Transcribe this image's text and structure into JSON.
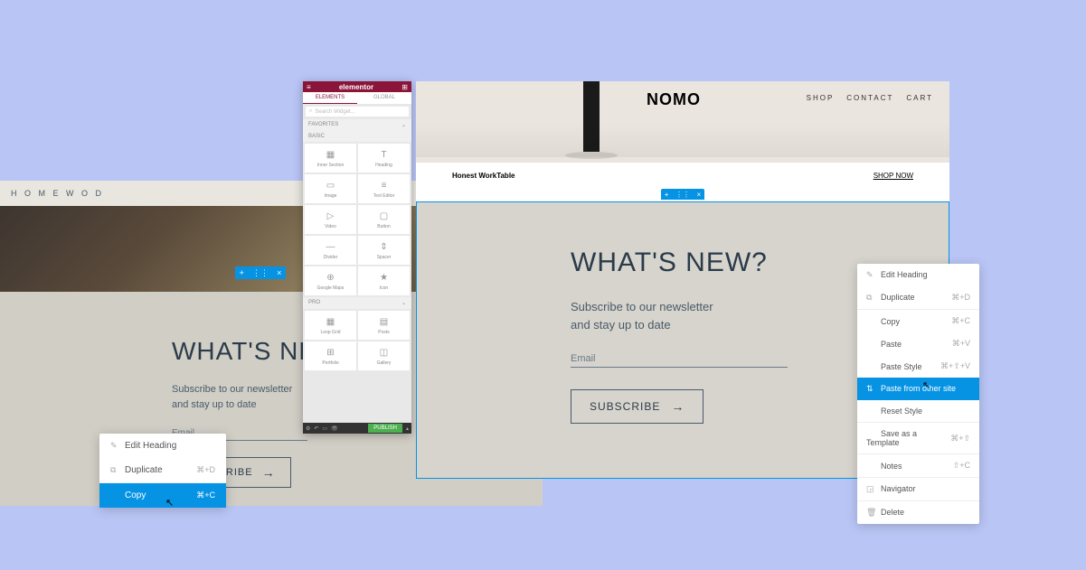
{
  "left_preview": {
    "logo": "H O M E W O D",
    "heading": "WHAT'S NEW?",
    "subscribe_text": "Subscribe to our newsletter\nand stay up to date",
    "email_placeholder": "Email",
    "subscribe_button": "SUBSCRIBE"
  },
  "left_context_menu": {
    "edit_heading": "Edit Heading",
    "duplicate": "Duplicate",
    "duplicate_shortcut": "⌘+D",
    "copy": "Copy",
    "copy_shortcut": "⌘+C"
  },
  "elementor": {
    "title": "elementor",
    "tabs": {
      "elements": "ELEMENTS",
      "global": "GLOBAL"
    },
    "search_placeholder": "Search Widget...",
    "sections": {
      "favorites": "FAVORITES",
      "basic": "BASIC",
      "pro": "PRO"
    },
    "widgets_basic": [
      {
        "label": "Inner Section",
        "icon": "▦"
      },
      {
        "label": "Heading",
        "icon": "T"
      },
      {
        "label": "Image",
        "icon": "▭"
      },
      {
        "label": "Text Editor",
        "icon": "≡"
      },
      {
        "label": "Video",
        "icon": "▷"
      },
      {
        "label": "Button",
        "icon": "▢"
      },
      {
        "label": "Divider",
        "icon": "—"
      },
      {
        "label": "Spacer",
        "icon": "⇕"
      },
      {
        "label": "Google Maps",
        "icon": "⊕"
      },
      {
        "label": "Icon",
        "icon": "★"
      }
    ],
    "widgets_pro": [
      {
        "label": "Loop Grid",
        "icon": "▦"
      },
      {
        "label": "Posts",
        "icon": "▤"
      },
      {
        "label": "Portfolio",
        "icon": "⊞"
      },
      {
        "label": "Gallery",
        "icon": "◫"
      }
    ],
    "publish": "PUBLISH"
  },
  "right_preview": {
    "logo": "NOMO",
    "nav": {
      "shop": "SHOP",
      "contact": "CONTACT",
      "cart": "CART"
    },
    "product_name": "Honest WorkTable",
    "shop_now": "SHOP NOW",
    "heading": "WHAT'S NEW?",
    "subscribe_text": "Subscribe to our newsletter\nand stay up to date",
    "email_placeholder": "Email",
    "subscribe_button": "SUBSCRIBE"
  },
  "right_context_menu": {
    "edit_heading": "Edit Heading",
    "duplicate": "Duplicate",
    "duplicate_shortcut": "⌘+D",
    "copy": "Copy",
    "copy_shortcut": "⌘+C",
    "paste": "Paste",
    "paste_shortcut": "⌘+V",
    "paste_style": "Paste Style",
    "paste_style_shortcut": "⌘+⇧+V",
    "paste_from_other": "Paste from other site",
    "reset_style": "Reset Style",
    "save_template": "Save as a Template",
    "save_template_shortcut": "⌘+⇧",
    "notes": "Notes",
    "notes_shortcut": "⇧+C",
    "navigator": "Navigator",
    "delete": "Delete"
  }
}
